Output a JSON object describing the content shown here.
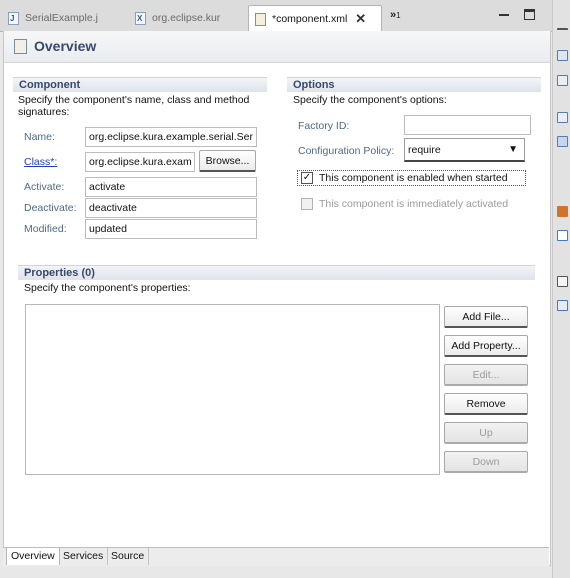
{
  "tabs": [
    {
      "label": "SerialExample.j",
      "icon": "java-file-icon",
      "icon_glyph": "J"
    },
    {
      "label": "org.eclipse.kur",
      "icon": "manifest-file-icon",
      "icon_glyph": "X"
    },
    {
      "label": "*component.xml",
      "icon": "component-xml-icon",
      "icon_glyph": "",
      "active": true
    }
  ],
  "tab_overflow": {
    "glyph": "»",
    "count": "1"
  },
  "page_title": "Overview",
  "component": {
    "title": "Component",
    "description": "Specify the component's name, class and method signatures:",
    "name_label": "Name:",
    "name_value": "org.eclipse.kura.example.serial.Ser",
    "class_label": "Class*:",
    "class_value": "org.eclipse.kura.exam",
    "browse_label": "Browse...",
    "activate_label": "Activate:",
    "activate_value": "activate",
    "deactivate_label": "Deactivate:",
    "deactivate_value": "deactivate",
    "modified_label": "Modified:",
    "modified_value": "updated"
  },
  "options": {
    "title": "Options",
    "description": "Specify the component's options:",
    "factory_label": "Factory ID:",
    "factory_value": "",
    "policy_label": "Configuration Policy:",
    "policy_value": "require",
    "enabled_label": "This component is enabled when started",
    "enabled_checked": true,
    "immediate_label": "This component is immediately activated",
    "immediate_checked": false
  },
  "properties": {
    "title": "Properties (0)",
    "description": "Specify the component's properties:",
    "buttons": {
      "add_file": "Add File...",
      "add_property": "Add Property...",
      "edit": "Edit...",
      "remove": "Remove",
      "up": "Up",
      "down": "Down"
    }
  },
  "bottom_tabs": [
    "Overview",
    "Services",
    "Source"
  ],
  "colors": {
    "section_title": "#36496b",
    "label": "#4e6a86",
    "link": "#1a44b4",
    "disabled_text": "#9b9b9b"
  }
}
